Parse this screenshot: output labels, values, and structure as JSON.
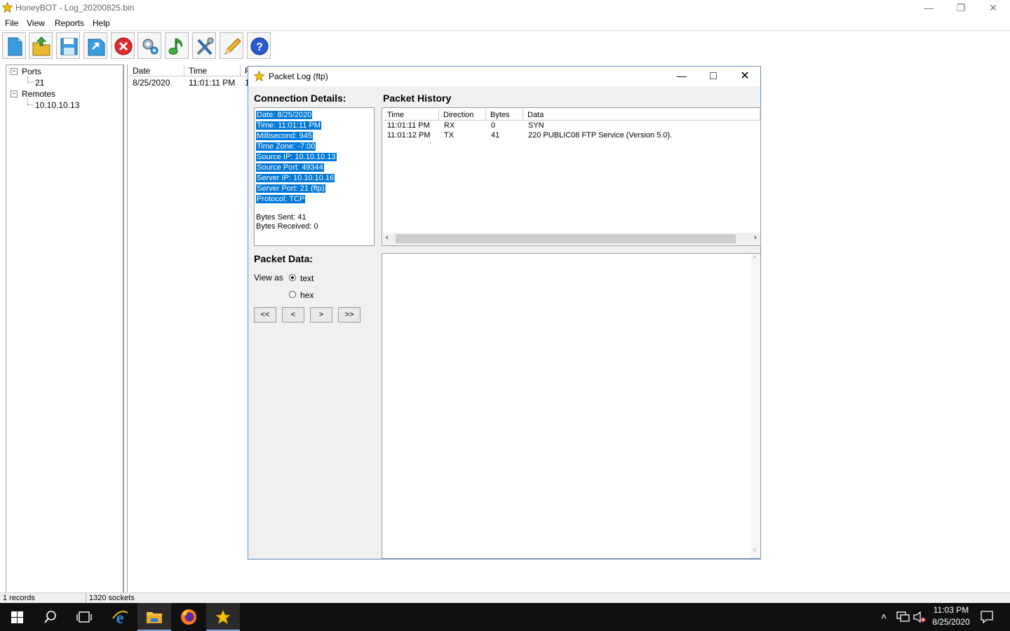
{
  "app": {
    "title": "HoneyBOT - Log_20200825.bin",
    "menu": [
      "File",
      "View",
      "Reports",
      "Help"
    ],
    "toolbar": [
      "new-icon",
      "open-icon",
      "save-icon",
      "export-icon",
      "stop-icon",
      "settings-icon",
      "sound-icon",
      "tools-icon",
      "edit-icon",
      "help-icon"
    ]
  },
  "tree": {
    "ports_label": "Ports",
    "port_item": "21",
    "remotes_label": "Remotes",
    "remote_item": "10.10.10.13"
  },
  "list": {
    "columns": [
      "Date",
      "Time",
      "F"
    ],
    "row": {
      "date": "8/25/2020",
      "time": "11:01:11 PM",
      "f": "1"
    }
  },
  "status": {
    "records": "1 records",
    "sockets": "1320 sockets"
  },
  "dialog": {
    "title": "Packet Log (ftp)",
    "connection_title": "Connection Details:",
    "details": [
      "Date: 8/25/2020",
      "Time: 11:01:11 PM",
      "Millisecond: 945",
      "Time Zone: -7:00",
      "Source IP: 10.10.10.13",
      "Source Port: 49344",
      "Server IP: 10.10.10.16",
      "Server Port: 21 (ftp)",
      "Protocol: TCP"
    ],
    "bytes_sent": "Bytes Sent: 41",
    "bytes_received": "Bytes Received: 0",
    "history_title": "Packet History",
    "history_columns": [
      "Time",
      "Direction",
      "Bytes",
      "Data"
    ],
    "history_rows": [
      {
        "time": "11:01:11 PM",
        "dir": "RX",
        "bytes": "0",
        "data": "SYN"
      },
      {
        "time": "11:01:12 PM",
        "dir": "TX",
        "bytes": "41",
        "data": "220 PUBLIC08 FTP Service (Version 5.0)."
      }
    ],
    "packet_data_title": "Packet Data:",
    "view_as": "View as",
    "opt_text": "text",
    "opt_hex": "hex",
    "nav": [
      "<<",
      "<",
      ">",
      ">>"
    ]
  },
  "taskbar": {
    "time": "11:03 PM",
    "date": "8/25/2020"
  }
}
